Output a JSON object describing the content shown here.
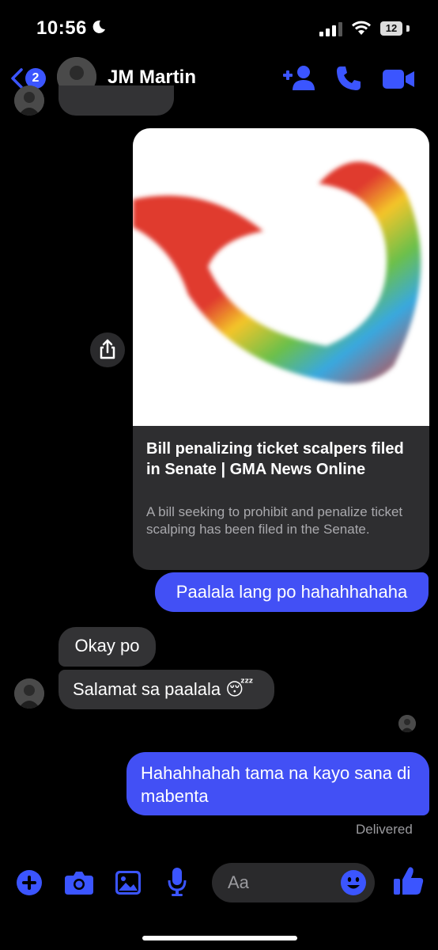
{
  "status_bar": {
    "time": "10:56",
    "battery": "12"
  },
  "header": {
    "back_badge": "2",
    "contact_name": "JM Martin"
  },
  "link_card": {
    "title": "Bill penalizing ticket scalpers filed in Senate | GMA News Online",
    "description": "A bill seeking to prohibit and penalize ticket scalping has been filed in the Senate."
  },
  "messages": [
    {
      "direction": "outgoing",
      "text": "Paalala lang po hahahhahaha"
    },
    {
      "direction": "incoming",
      "text": "Okay po"
    },
    {
      "direction": "incoming",
      "text": "Salamat sa paalala 😴"
    },
    {
      "direction": "outgoing",
      "text": "Hahahhahah tama na kayo sana di mabenta"
    }
  ],
  "delivery_status": "Delivered",
  "composer": {
    "placeholder": "Aa"
  },
  "colors": {
    "accent": "#3b55ff",
    "outgoing_bubble": "#4250f5",
    "incoming_bubble": "#333335"
  },
  "icons": [
    "back-chevron-icon",
    "add-person-icon",
    "phone-icon",
    "video-icon",
    "share-icon",
    "plus-icon",
    "camera-icon",
    "gallery-icon",
    "mic-icon",
    "emoji-icon",
    "thumbs-up-icon"
  ]
}
